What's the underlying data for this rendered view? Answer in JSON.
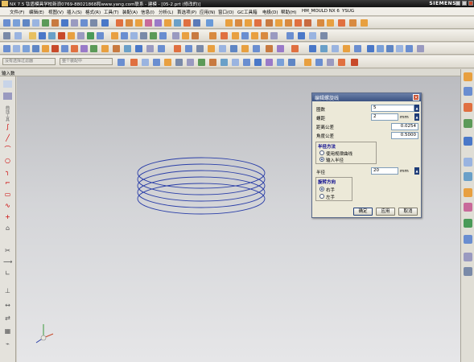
{
  "app": {
    "title": "NX 7.5 钛盾模具学校新浪0769-88021868和www.yang.com联系 - 建模 - [05-2.prt (修改的)]",
    "brand": "SIEMENS"
  },
  "menu": [
    "文件(F)",
    "编辑(E)",
    "视图(V)",
    "插入(S)",
    "格式(R)",
    "工具(T)",
    "装配(A)",
    "信息(I)",
    "分析(L)",
    "首选项(P)",
    "应用(N)",
    "窗口(O)",
    "GC工具箱",
    "电极(D)",
    "帮助(H)",
    "HM_MOULD NX 6",
    "YSUG"
  ],
  "toolbar": {
    "filter_placeholder": "没有选择过滤器",
    "assembly_placeholder": "整个装配中"
  },
  "panel": {
    "label": "输入数",
    "vertical_label": "曲线工具"
  },
  "dialog": {
    "title": "编辑螺旋线",
    "turns_label": "圈数",
    "turns_value": "5",
    "pitch_label": "螺距",
    "pitch_value": "2",
    "pitch_unit": "mm",
    "dist_tol_label": "距离公差",
    "dist_tol_value": "0.0254",
    "angle_tol_label": "角度公差",
    "angle_tol_value": "0.5000",
    "radius_group_title": "半径方法",
    "radius_opt1": "使用规律曲线",
    "radius_opt2": "输入半径",
    "radius_label": "半径",
    "radius_value": "20",
    "radius_unit": "mm",
    "rotation_group_title": "旋转方向",
    "rot_opt1": "右手",
    "rot_opt2": "左手",
    "ok_label": "确定",
    "apply_label": "应用",
    "cancel_label": "取消"
  },
  "colors": {
    "helix": "#2a3ea8",
    "dialog_title": "#3c5382",
    "icon_orange": "#e8a040",
    "icon_blue": "#4a78c8"
  }
}
